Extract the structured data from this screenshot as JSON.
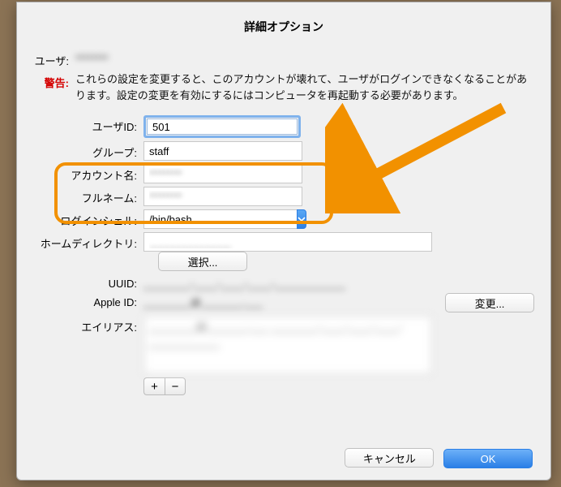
{
  "title": "詳細オプション",
  "user_row": {
    "label": "ユーザ:",
    "value": "********"
  },
  "warning": {
    "label": "警告:",
    "text": "これらの設定を変更すると、このアカウントが壊れて、ユーザがログインできなくなることがあります。設定の変更を有効にするにはコンピュータを再起動する必要があります。"
  },
  "fields": {
    "user_id": {
      "label": "ユーザID:",
      "value": "501"
    },
    "group": {
      "label": "グループ:",
      "value": "staff"
    },
    "account_name": {
      "label": "アカウント名:",
      "value": "********"
    },
    "full_name": {
      "label": "フルネーム:",
      "value": "********"
    },
    "login_shell": {
      "label": "ログインシェル:",
      "value": "/bin/bash"
    },
    "home_dir": {
      "label": "ホームディレクトリ:",
      "value": "______________"
    },
    "uuid": {
      "label": "UUID:",
      "value": "________-____-____-____-____________"
    },
    "apple_id": {
      "label": "Apple ID:",
      "value": "________@_______.___"
    },
    "alias": {
      "label": "エイリアス:",
      "value": "________@_______.___ ________-____-____-____-____________"
    }
  },
  "buttons": {
    "choose": "選択...",
    "change": "変更...",
    "cancel": "キャンセル",
    "ok": "OK",
    "plus": "+",
    "minus": "−"
  },
  "annotation": {
    "color": "#f29100"
  }
}
